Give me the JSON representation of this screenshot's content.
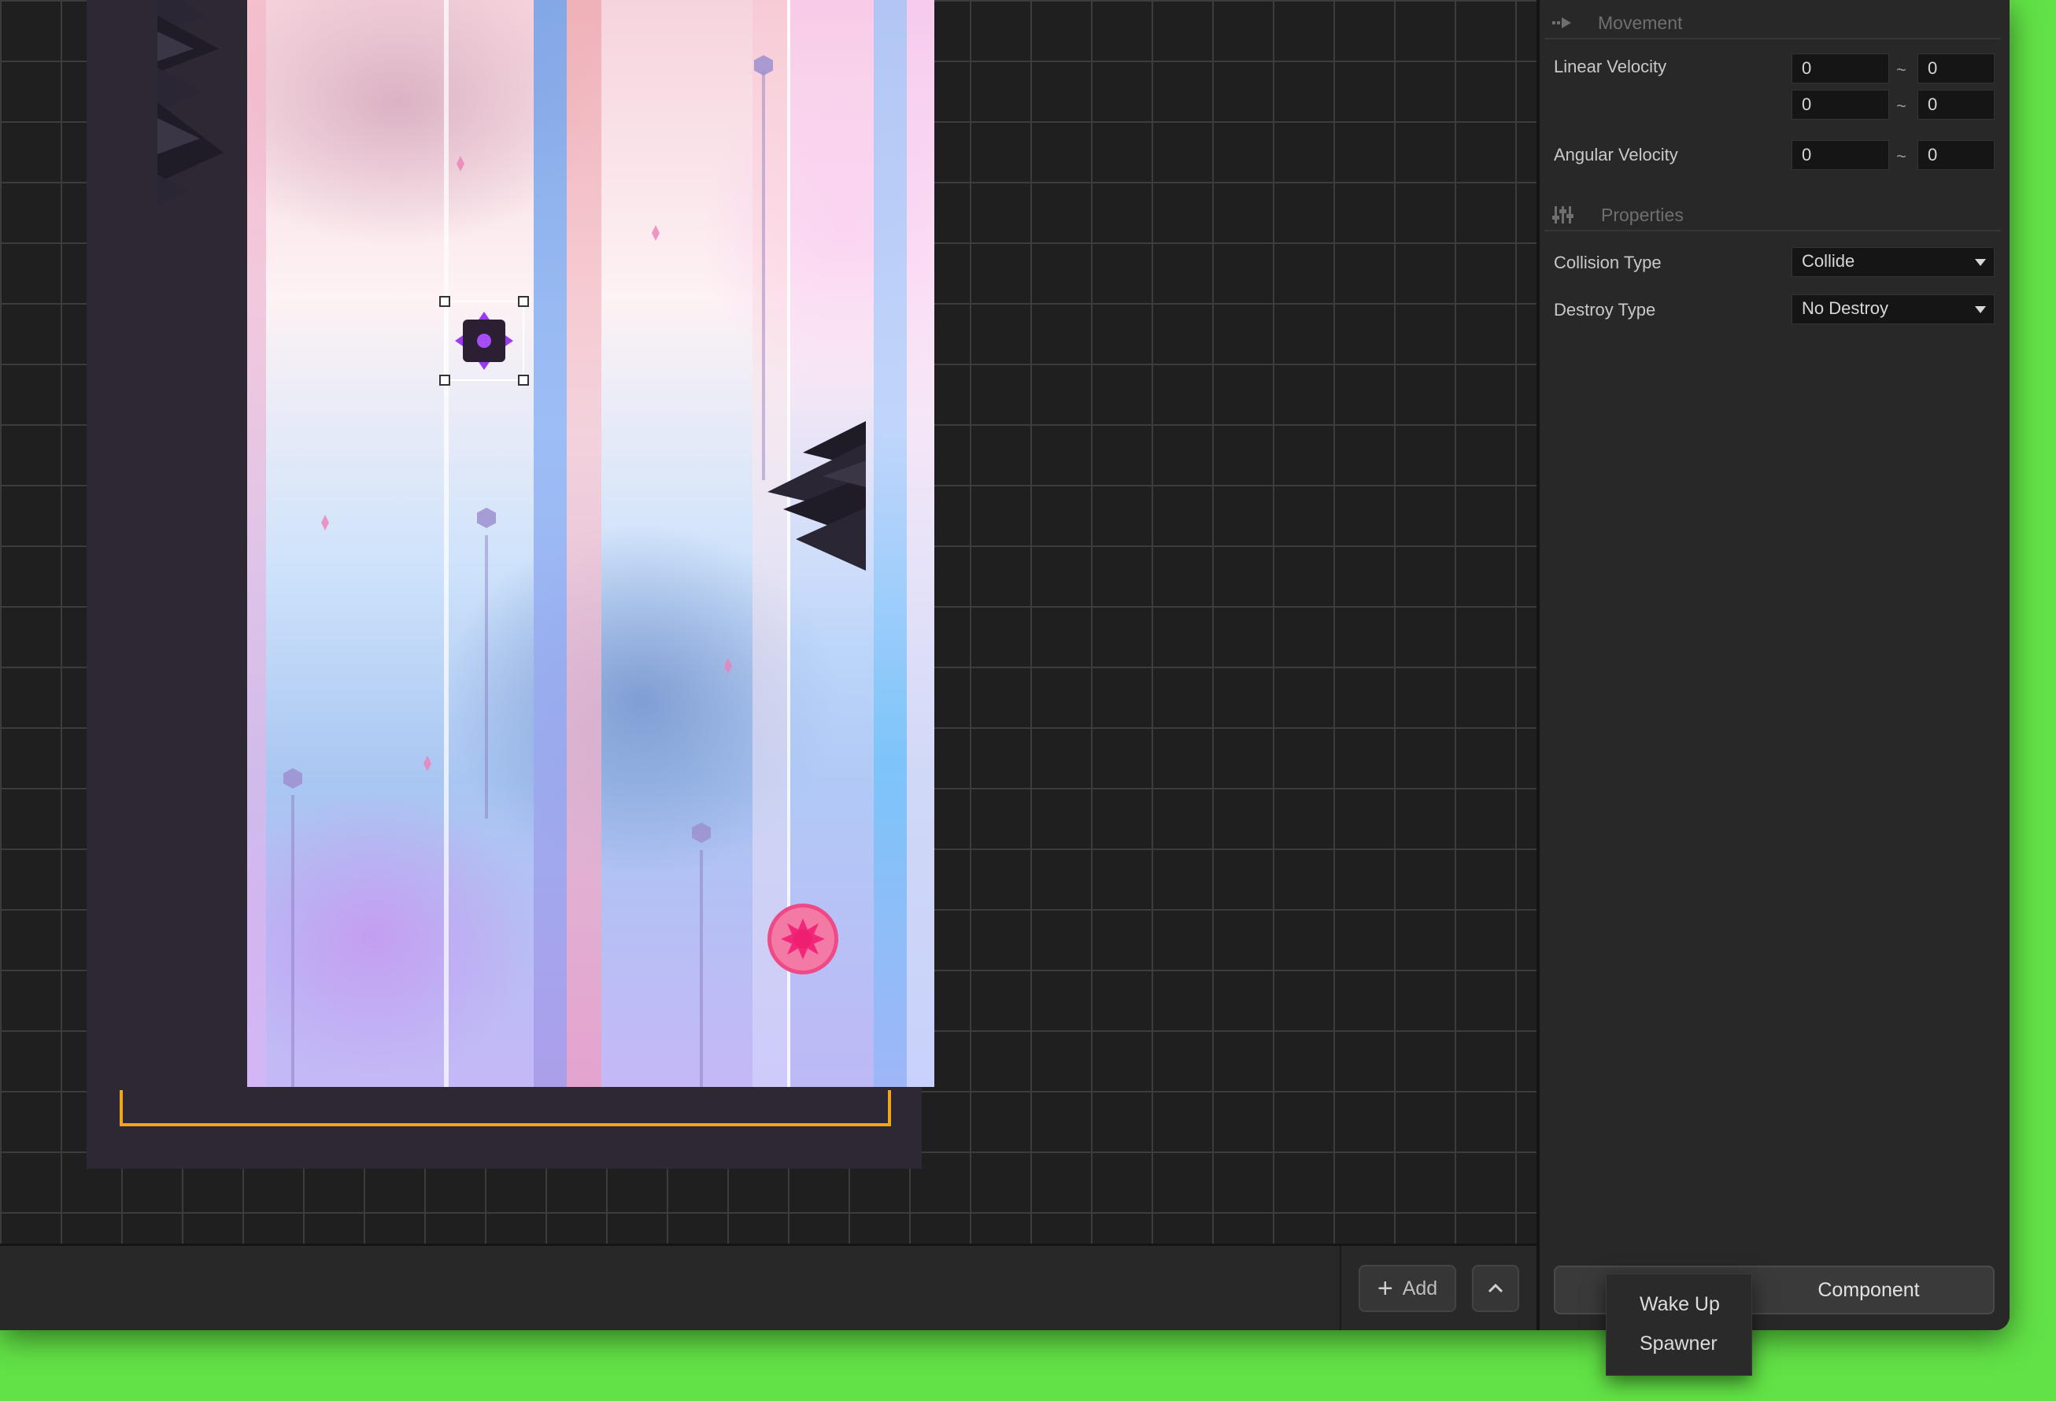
{
  "inspector": {
    "movement": {
      "title": "Movement",
      "linear_velocity_label": "Linear Velocity",
      "linear_velocity": [
        [
          "0",
          "0"
        ],
        [
          "0",
          "0"
        ]
      ],
      "angular_velocity_label": "Angular Velocity",
      "angular_velocity": [
        "0",
        "0"
      ],
      "range_separator": "~"
    },
    "properties": {
      "title": "Properties",
      "collision_type_label": "Collision Type",
      "collision_type_value": "Collide",
      "destroy_type_label": "Destroy Type",
      "destroy_type_value": "No Destroy"
    },
    "add_component_label": "Component"
  },
  "bottom_bar": {
    "add_label": "Add"
  },
  "component_menu": {
    "items": [
      "Wake Up",
      "Spawner"
    ]
  },
  "icons": {
    "movement": "arrow-right-icon",
    "properties": "sliders-icon",
    "add": "plus-icon",
    "expand": "chevron-up-icon",
    "dropdown": "caret-down-icon"
  },
  "colors": {
    "backdrop": "#62e246",
    "goal_marker": "#f2a516",
    "saw": "#f2267a",
    "enemy_accent": "#9b3bf0"
  }
}
